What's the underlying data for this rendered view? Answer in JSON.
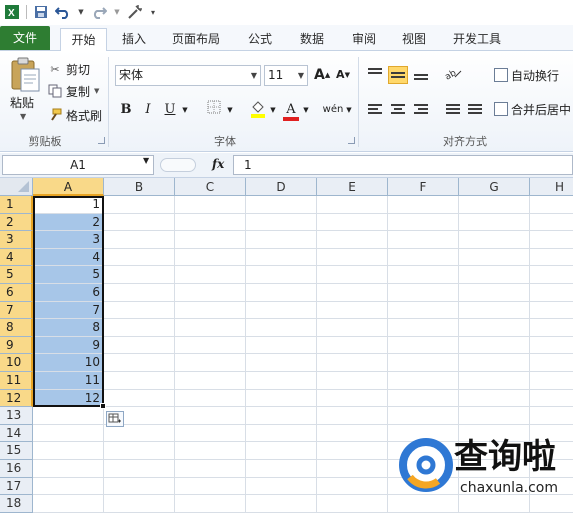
{
  "quick_access": [
    "excel-logo-icon",
    "save-icon",
    "undo-icon",
    "redo-icon",
    "customize-icon"
  ],
  "tabs": [
    {
      "label": "文件",
      "name": "tab-file"
    },
    {
      "label": "开始",
      "name": "tab-home"
    },
    {
      "label": "插入",
      "name": "tab-insert"
    },
    {
      "label": "页面布局",
      "name": "tab-page-layout"
    },
    {
      "label": "公式",
      "name": "tab-formulas"
    },
    {
      "label": "数据",
      "name": "tab-data"
    },
    {
      "label": "审阅",
      "name": "tab-review"
    },
    {
      "label": "视图",
      "name": "tab-view"
    },
    {
      "label": "开发工具",
      "name": "tab-developer"
    }
  ],
  "clipboard": {
    "paste": "粘贴",
    "cut": "剪切",
    "copy": "复制",
    "format_painter": "格式刷",
    "group_label": "剪贴板"
  },
  "font": {
    "name": "宋体",
    "size": "11",
    "bold": "B",
    "italic": "I",
    "underline": "U",
    "font_color_letter": "A",
    "grow": "A",
    "shrink": "A",
    "phonetic": "wén",
    "group_label": "字体"
  },
  "alignment": {
    "wrap_text": "自动换行",
    "merge_center": "合并后居中",
    "group_label": "对齐方式"
  },
  "formula_bar": {
    "name_box": "A1",
    "fx": "fx",
    "value": "1"
  },
  "columns": [
    "A",
    "B",
    "C",
    "D",
    "E",
    "F",
    "G",
    "H"
  ],
  "rows": [
    "1",
    "2",
    "3",
    "4",
    "5",
    "6",
    "7",
    "8",
    "9",
    "10",
    "11",
    "12",
    "13",
    "14",
    "15",
    "16",
    "17",
    "18"
  ],
  "column_a_values": [
    "1",
    "2",
    "3",
    "4",
    "5",
    "6",
    "7",
    "8",
    "9",
    "10",
    "11",
    "12"
  ],
  "watermark": {
    "title": "查询啦",
    "url": "chaxunla.com"
  },
  "colors": {
    "file_tab": "#2e7d32",
    "selection_fill": "#a7c6e8",
    "header_highlight": "#f9d989"
  }
}
